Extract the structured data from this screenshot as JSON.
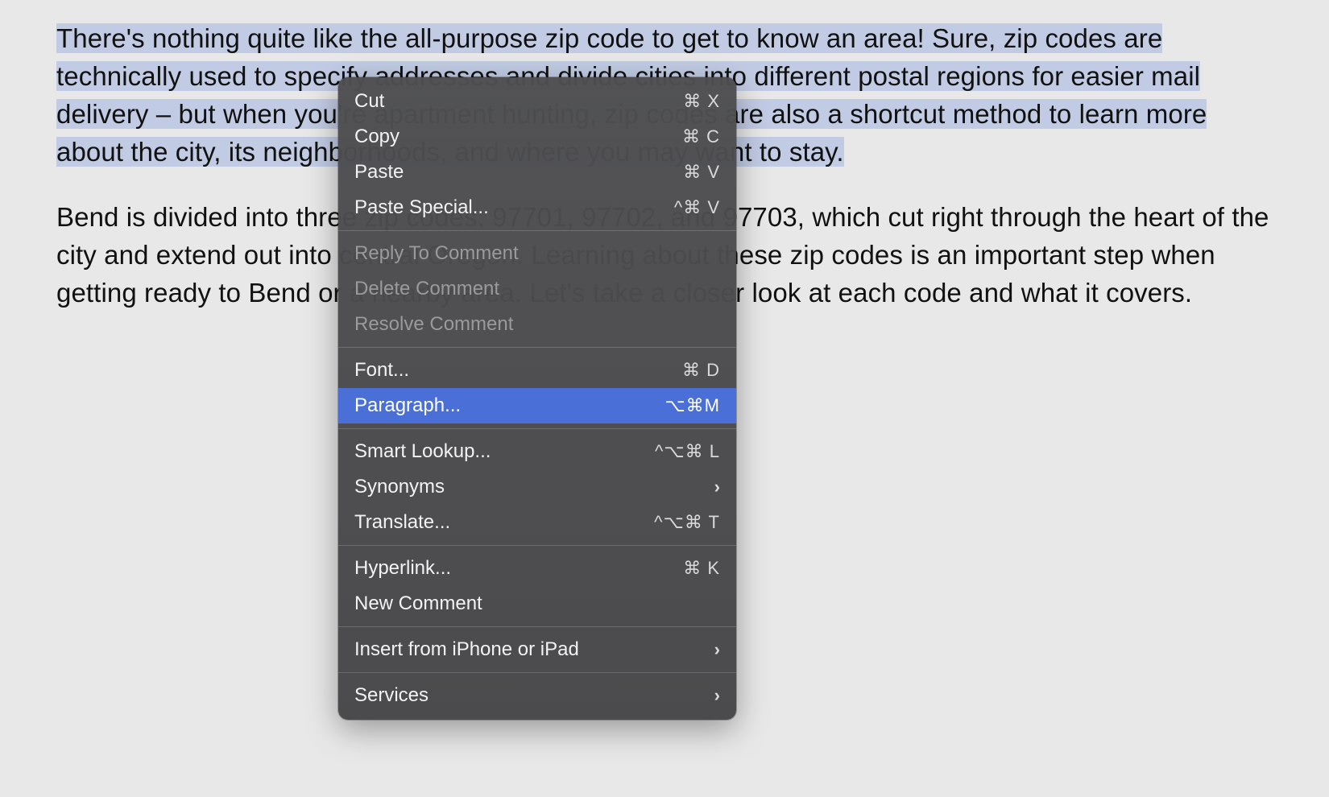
{
  "document": {
    "paragraph1": {
      "selected": "There's nothing quite like the all-purpose zip code to get to know an area! Sure, zip codes are technically used to specify addresses and divide cities into different postal regions for easier mail delivery – but when you're apartment hunting, zip codes are also a shortcut method to learn more about the city, its neighborhoods, and where you may want to stay."
    },
    "paragraph2": "Bend is divided into three zip codes: 97701, 97702, and 97703, which cut right through the heart of the city and extend out into central Oregon. Learning about these zip codes is an important step when getting ready to Bend or a nearby area. Let's take a closer look at each code and what it covers."
  },
  "menu": {
    "cut": {
      "label": "Cut",
      "shortcut": "⌘ X"
    },
    "copy": {
      "label": "Copy",
      "shortcut": "⌘ C"
    },
    "paste": {
      "label": "Paste",
      "shortcut": "⌘ V"
    },
    "paste_special": {
      "label": "Paste Special...",
      "shortcut": "^⌘ V"
    },
    "reply_comment": {
      "label": "Reply To Comment"
    },
    "delete_comment": {
      "label": "Delete Comment"
    },
    "resolve_comment": {
      "label": "Resolve Comment"
    },
    "font": {
      "label": "Font...",
      "shortcut": "⌘ D"
    },
    "paragraph": {
      "label": "Paragraph...",
      "shortcut": "⌥⌘M"
    },
    "smart_lookup": {
      "label": "Smart Lookup...",
      "shortcut": "^⌥⌘ L"
    },
    "synonyms": {
      "label": "Synonyms"
    },
    "translate": {
      "label": "Translate...",
      "shortcut": "^⌥⌘ T"
    },
    "hyperlink": {
      "label": "Hyperlink...",
      "shortcut": "⌘ K"
    },
    "new_comment": {
      "label": "New Comment"
    },
    "insert_device": {
      "label": "Insert from iPhone or iPad"
    },
    "services": {
      "label": "Services"
    }
  },
  "glyphs": {
    "chevron": "›"
  }
}
